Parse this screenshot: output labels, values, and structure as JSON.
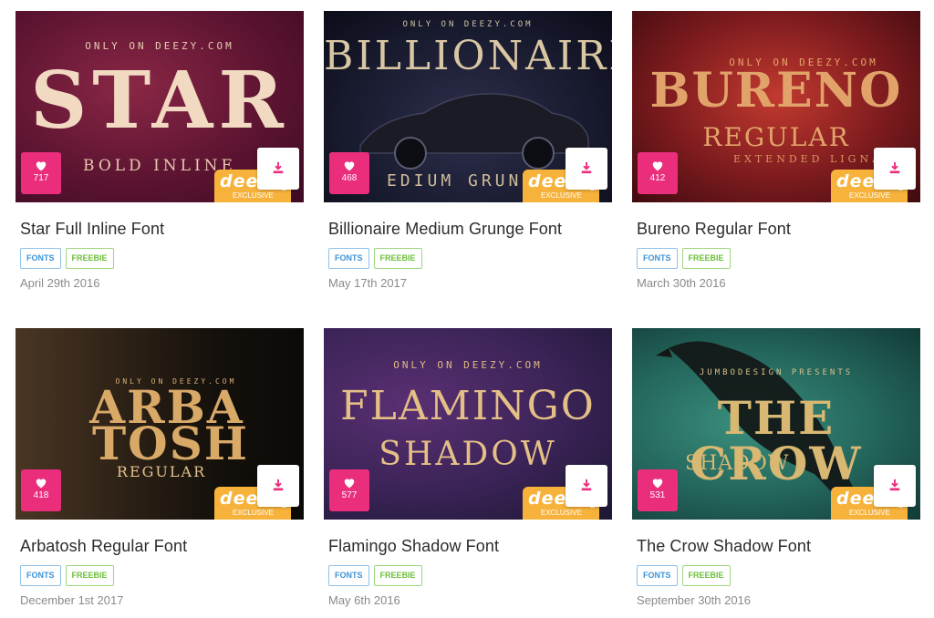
{
  "cards": [
    {
      "title": "Star Full Inline Font",
      "date": "April 29th 2016",
      "likes": "717",
      "tags": [
        "FONTS",
        "FREEBIE"
      ],
      "art": {
        "overline": "ONLY ON DEEZY.COM",
        "headline": "STAR",
        "subline": "BOLD INLINE"
      },
      "colors": {
        "bg1": "#7a1f3d",
        "bg2": "#3d0b22",
        "text": "#f1d9c2"
      }
    },
    {
      "title": "Billionaire Medium Grunge Font",
      "date": "May 17th 2017",
      "likes": "468",
      "tags": [
        "FONTS",
        "FREEBIE"
      ],
      "art": {
        "overline": "ONLY ON DEEZY.COM",
        "headline": "BILLIONAIRE",
        "subline": "EDIUM GRUNGE"
      },
      "colors": {
        "bg1": "#2b2c48",
        "bg2": "#0e0f1e",
        "text": "#d9c7a3"
      }
    },
    {
      "title": "Bureno Regular Font",
      "date": "March 30th 2016",
      "likes": "412",
      "tags": [
        "FONTS",
        "FREEBIE"
      ],
      "art": {
        "overline": "ONLY ON DEEZY.COM",
        "headline": "BURENO",
        "subline": "REGULAR",
        "subline2": "EXTENDED LIGNA"
      },
      "colors": {
        "bg1": "#b0322c",
        "bg2": "#4a0d10",
        "text": "#e2a36b"
      }
    },
    {
      "title": "Arbatosh Regular Font",
      "date": "December 1st 2017",
      "likes": "418",
      "tags": [
        "FONTS",
        "FREEBIE"
      ],
      "art": {
        "overline": "ONLY ON DEEZY.COM",
        "headline": "ARBA",
        "headline2": "TOSH",
        "subline": "REGULAR"
      },
      "colors": {
        "bg1": "#3a2a1c",
        "bg2": "#0f0b08",
        "text": "#d9a968"
      }
    },
    {
      "title": "Flamingo Shadow Font",
      "date": "May 6th 2016",
      "likes": "577",
      "tags": [
        "FONTS",
        "FREEBIE"
      ],
      "art": {
        "overline": "ONLY ON DEEZY.COM",
        "headline": "FLAMINGO",
        "subline": "SHADOW"
      },
      "colors": {
        "bg1": "#4a2a6a",
        "bg2": "#1e1433",
        "text": "#e4bf86"
      }
    },
    {
      "title": "The Crow Shadow Font",
      "date": "September 30th 2016",
      "likes": "531",
      "tags": [
        "FONTS",
        "FREEBIE"
      ],
      "art": {
        "overline": "JUMBODESIGN PRESENTS",
        "headline": "THE CROW",
        "subline": "SHADOW"
      },
      "colors": {
        "bg1": "#2f7a6c",
        "bg2": "#123a36",
        "text": "#d8b873"
      }
    }
  ],
  "badge": {
    "logo": "deeezy",
    "exclusive": "EXCLUSIVE"
  },
  "colors": {
    "like": "#ea2e7c",
    "badge": "#f7b23b",
    "tag_fonts": "#3d93d6",
    "tag_freebie": "#6cbf3a"
  },
  "icons": {
    "like": "heart-icon",
    "download": "download-icon"
  }
}
